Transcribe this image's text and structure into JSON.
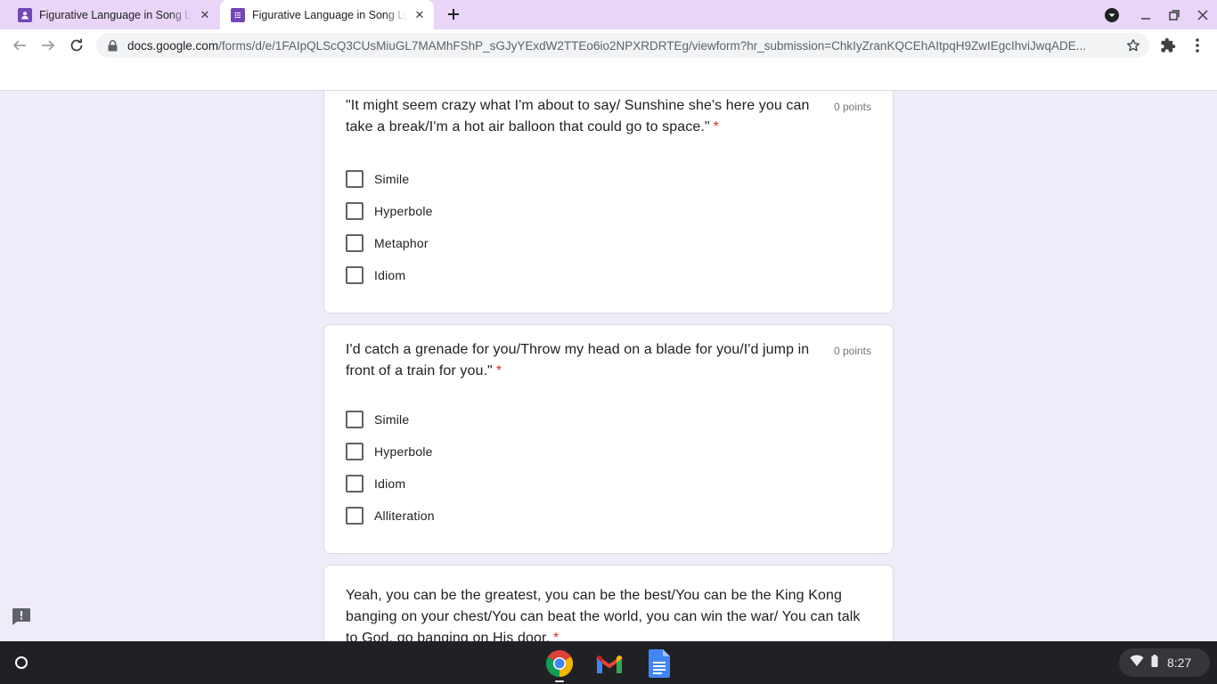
{
  "browser": {
    "tabs": [
      {
        "title": "Figurative Language in Song Lyrics",
        "active": false
      },
      {
        "title": "Figurative Language in Song Lyrics",
        "active": true
      }
    ],
    "url_host": "docs.google.com",
    "url_path": "/forms/d/e/1FAIpQLScQ3CUsMiuGL7MAMhFShP_sGJyYExdW2TTEo6io2NPXRDRTEg/viewform?hr_submission=ChkIyZranKQCEhAItpqH9ZwIEgcIhviJwqADE..."
  },
  "form": {
    "questions": [
      {
        "text": "\"It might seem crazy what I'm about to say/ Sunshine she's here you can take a break/I'm a hot air balloon that could go to space.\"",
        "required_mark": "*",
        "points": "0 points",
        "options": [
          "Simile",
          "Hyperbole",
          "Metaphor",
          "Idiom"
        ]
      },
      {
        "text": "I'd catch a grenade for you/Throw my head on a blade for you/I'd jump in front of a train for you.\"",
        "required_mark": "*",
        "points": "0 points",
        "options": [
          "Simile",
          "Hyperbole",
          "Idiom",
          "Alliteration"
        ]
      },
      {
        "text": "Yeah, you can be the greatest, you can be the best/You can be the King Kong banging on your chest/You can beat the world, you can win the war/ You can talk to God, go banging on His door.",
        "required_mark": "*"
      }
    ]
  },
  "shelf": {
    "apps": [
      "chrome-icon",
      "gmail-icon",
      "docs-icon"
    ],
    "time": "8:27"
  },
  "colors": {
    "tabstrip": "#e8d5f7",
    "page_background": "#f0ebf8",
    "forms_purple": "#7248b9",
    "required_red": "#d93025"
  }
}
